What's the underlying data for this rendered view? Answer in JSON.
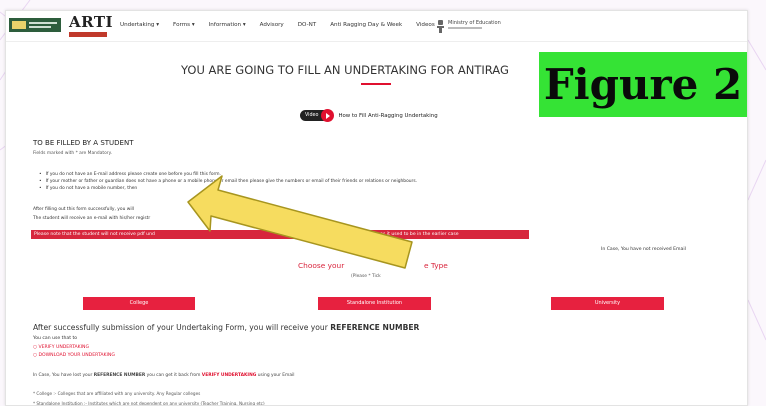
{
  "brand": {
    "logo_text": "ARTI",
    "ministry": "Ministry of Education"
  },
  "nav": {
    "items": [
      "Undertaking",
      "Forms",
      "Information",
      "Advisory",
      "DO-NT",
      "Anti Ragging Day & Week",
      "Videos"
    ]
  },
  "headline": "YOU ARE GOING TO FILL AN UNDERTAKING FOR ANTIRAG",
  "video": {
    "button_label": "Video",
    "link_text": "How to Fill Anti-Ragging Undertaking"
  },
  "form_intro": {
    "section_title": "TO BE FILLED BY A STUDENT",
    "mandatory_note": "Fields marked with * are Mandatory.",
    "bullets": [
      "If you do not have an E-mail address please create one before you fill this form.",
      "If your mother or father or guardian does not have a phone or a mobile phone or email then please give the numbers or email of their friends or relations or neighbours.",
      "If you do not have a mobile number, then"
    ],
    "para_line1": "After filling out this form successfully, you will",
    "para_line2": "The student will receive an e-mail with his/her registr",
    "alert": "Please note that the student will not receive pdf und",
    "alert_tail": "in case them as it used to be in the earlier case"
  },
  "right_note": "In Case, You have not received Email",
  "institution_type": {
    "heading_start": "Choose your",
    "heading_end": "e Type",
    "required_label": "(Please * Tick",
    "options": [
      "College",
      "Standalone Institution",
      "University"
    ]
  },
  "after_submission": {
    "text_start": "After successfully submission of your Undertaking Form, you will receive your ",
    "text_bold": "REFERENCE NUMBER",
    "you_can": "You can use that to",
    "links": [
      "VERIFY UNDERTAKING",
      "DOWNLOAD YOUR UNDERTAKING"
    ],
    "incase_start": "In Case, You have lost your ",
    "incase_ref": "REFERENCE NUMBER",
    "incase_mid": " you can get it back from ",
    "incase_link": "VERIFY UNDERTAKING",
    "incase_end": " using your Email"
  },
  "footnotes": [
    "* College :- Colleges that are affiliated with any university. Any Regular colleges",
    "* Standalone Institution :- Institutes which are not dependent on any university (Teacher Training, Nursing etc)"
  ],
  "figure_label": "Figure 2",
  "colors": {
    "accent": "#e7213f",
    "figure_bg": "#35e335",
    "arrow_fill": "#f6dc5f",
    "arrow_stroke": "#a7951f"
  }
}
